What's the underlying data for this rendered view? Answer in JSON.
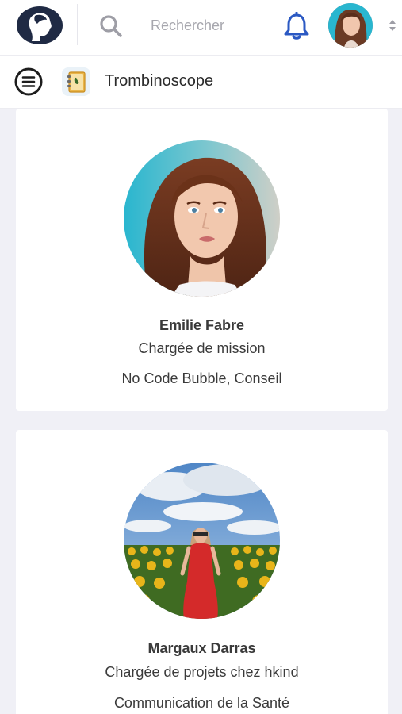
{
  "header": {
    "logo_icon": "profile-silhouette-logo-icon",
    "search": {
      "placeholder": "Rechercher",
      "value": ""
    },
    "notification_icon": "bell-icon",
    "user_avatar": "user-avatar-photo",
    "account_switcher_icon": "chevron-updown-icon"
  },
  "subheader": {
    "menu_icon": "hamburger-menu-icon",
    "app_icon": "address-book-icon",
    "title": "Trombinoscope"
  },
  "people": [
    {
      "name": "Emilie Fabre",
      "role": "Chargée de mission",
      "tags": "No Code Bubble, Conseil",
      "photo": "portrait-woman-red-hair"
    },
    {
      "name": "Margaux Darras",
      "role": "Chargée de projets chez hkind",
      "tags": "Communication de la Santé",
      "photo": "woman-red-dress-sunflower-field"
    }
  ],
  "colors": {
    "accent_blue": "#2b59c3",
    "background": "#f0f0f6",
    "card": "#ffffff",
    "icon_gray": "#9e9ea6"
  }
}
